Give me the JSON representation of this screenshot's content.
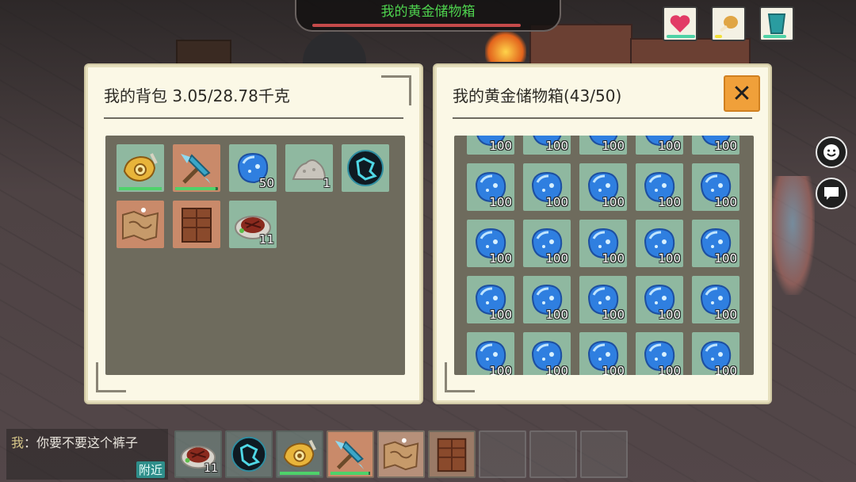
{
  "top_bar": {
    "title": "我的黄金储物箱",
    "health_fraction": 0.9
  },
  "status": {
    "heart": {
      "icon": "heart-icon",
      "fill": 1.0,
      "color": "#4ed2a6"
    },
    "hunger": {
      "icon": "drumstick-icon",
      "fill": 0.25,
      "color": "#f3e23b"
    },
    "thirst": {
      "icon": "water-cup-icon",
      "fill": 0.8,
      "color": "#4ed2a6"
    }
  },
  "backpack": {
    "title": "我的背包  3.05/28.78千克",
    "slots": [
      {
        "item": "golden-horn-icon",
        "count": "",
        "durability": 1.0
      },
      {
        "item": "crystal-pickaxe-icon",
        "count": "",
        "durability": 0.95
      },
      {
        "item": "blue-crystal-icon",
        "count": "50"
      },
      {
        "item": "stone-pile-icon",
        "count": "1"
      },
      {
        "item": "dark-orb-icon",
        "count": ""
      },
      {
        "item": "map-icon",
        "count": ""
      },
      {
        "item": "wooden-crate-icon",
        "count": ""
      },
      {
        "item": "steak-plate-icon",
        "count": "11"
      }
    ]
  },
  "storage": {
    "title": "我的黄金储物箱(43/50)",
    "close_label": "✕",
    "item": "blue-crystal-icon",
    "rows": [
      [
        "100",
        "100",
        "100",
        "100",
        "100"
      ],
      [
        "100",
        "100",
        "100",
        "100",
        "100"
      ],
      [
        "100",
        "100",
        "100",
        "100",
        "100"
      ],
      [
        "100",
        "100",
        "100",
        "100",
        "100"
      ],
      [
        "100",
        "100",
        "100",
        "100",
        "100"
      ]
    ]
  },
  "chat": {
    "speaker": "我",
    "message": "：你要不要这个裤子",
    "channel": "附近"
  },
  "hotbar": [
    {
      "item": "steak-plate-icon",
      "count": "11"
    },
    {
      "item": "dark-orb-icon",
      "count": ""
    },
    {
      "item": "golden-horn-icon",
      "count": "",
      "durability": 1.0
    },
    {
      "item": "crystal-pickaxe-icon",
      "count": "",
      "durability": 0.95
    },
    {
      "item": "map-icon",
      "count": ""
    },
    {
      "item": "wooden-crate-icon",
      "count": ""
    },
    {
      "item": "",
      "count": ""
    },
    {
      "item": "",
      "count": ""
    },
    {
      "item": "",
      "count": ""
    }
  ]
}
